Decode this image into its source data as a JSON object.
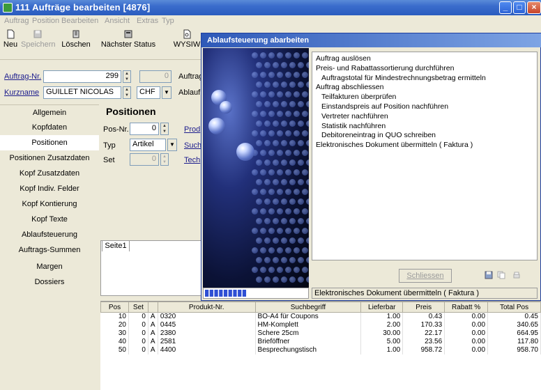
{
  "window": {
    "title": "111 Aufträge bearbeiten [4876]",
    "min_label": "_",
    "max_label": "□",
    "close_label": "×"
  },
  "menu": [
    "Auftrag",
    "Position",
    "Bearbeiten",
    "Ansicht",
    "Extras",
    "Typ"
  ],
  "toolbar": {
    "new": "Neu",
    "save": "Speichern",
    "delete": "Löschen",
    "next_status": "Nächster Status",
    "wysiwyg": "WYSIW"
  },
  "order": {
    "order_no_label": "Auftrag-Nr.",
    "order_no": "299",
    "order_counter": "0",
    "order_right_label": "Auftrag",
    "short_name_label": "Kurzname",
    "short_name": "GUILLET NICOLAS",
    "currency": "CHF",
    "flow_right_label": "Ablauf"
  },
  "sidebar": {
    "items": [
      "Allgemein",
      "Kopfdaten",
      "Positionen",
      "Positionen Zusatzdaten",
      "Kopf Zusatzdaten",
      "Kopf Indiv. Felder",
      "Kopf Kontierung",
      "Kopf Texte",
      "Ablaufsteuerung",
      "Auftrags-Summen",
      "Margen",
      "Dossiers"
    ],
    "active_index": 2
  },
  "positions": {
    "title": "Positionen",
    "pos_nr_label": "Pos-Nr.",
    "pos_nr": "0",
    "type_label": "Typ",
    "type_value": "Artikel",
    "set_label": "Set",
    "set_value": "0",
    "link_product": "Prod",
    "link_search": "Such",
    "link_tech": "Tech",
    "tab_label": "Seite1"
  },
  "grid": {
    "columns": [
      "Pos",
      "Set",
      "",
      "Produkt-Nr.",
      "Suchbegriff",
      "Lieferbar",
      "Preis",
      "Rabatt %",
      "Total Pos"
    ],
    "rows": [
      [
        "10",
        "0",
        "A",
        "0320",
        "BO-A4 für Coupons",
        "1.00",
        "0.43",
        "0.00",
        "0.45"
      ],
      [
        "20",
        "0",
        "A",
        "0445",
        "HM-Komplett",
        "2.00",
        "170.33",
        "0.00",
        "340.65"
      ],
      [
        "30",
        "0",
        "A",
        "2380",
        "Schere 25cm",
        "30.00",
        "22.17",
        "0.00",
        "664.95"
      ],
      [
        "40",
        "0",
        "A",
        "2581",
        "Brieföffner",
        "5.00",
        "23.56",
        "0.00",
        "117.80"
      ],
      [
        "50",
        "0",
        "A",
        "4400",
        "Besprechungstisch",
        "1.00",
        "958.72",
        "0.00",
        "958.70"
      ]
    ]
  },
  "dialog": {
    "title": "Ablaufsteuerung abarbeiten",
    "steps": [
      {
        "text": "Auftrag auslösen",
        "indent": false
      },
      {
        "text": "Preis- und Rabattassortierung durchführen",
        "indent": false
      },
      {
        "text": "Auftragstotal für Mindestrechnungsbetrag ermitteln",
        "indent": true
      },
      {
        "text": "Auftrag abschliessen",
        "indent": false
      },
      {
        "text": "Teilfakturen überprüfen",
        "indent": true
      },
      {
        "text": "Einstandspreis auf Position nachführen",
        "indent": true
      },
      {
        "text": "Vertreter nachführen",
        "indent": true
      },
      {
        "text": "Statistik nachführen",
        "indent": true
      },
      {
        "text": "Debitoreneintrag in QUO schreiben",
        "indent": true
      },
      {
        "text": "Elektronisches Dokument übermitteln ( Faktura )",
        "indent": false
      }
    ],
    "close_button": "Schliessen",
    "status": "Elektronisches Dokument übermitteln ( Faktura )",
    "progress_segments": 9,
    "progress_total_segments": 22
  },
  "colors": {
    "title_blue": "#2a5cbf",
    "progress": "#2e4fd4"
  }
}
